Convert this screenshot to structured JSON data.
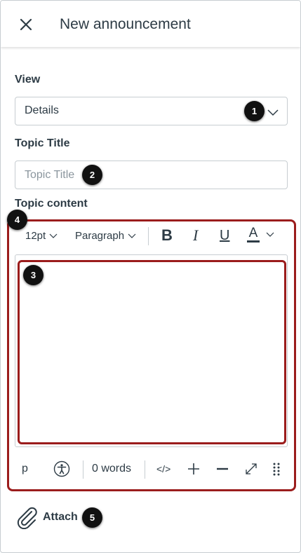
{
  "header": {
    "title": "New announcement",
    "close_icon": "close-icon"
  },
  "view": {
    "label": "View",
    "selected": "Details"
  },
  "topic_title": {
    "label": "Topic Title",
    "placeholder": "Topic Title"
  },
  "topic_content": {
    "label": "Topic content",
    "toolbar": {
      "font_size": "12pt",
      "block_format": "Paragraph",
      "bold": "B",
      "italic": "I",
      "underline": "U",
      "text_color": "A"
    },
    "statusbar": {
      "path": "p",
      "word_count": "0 words",
      "html_toggle": "</>"
    }
  },
  "attach": {
    "label": "Attach"
  },
  "callouts": [
    "1",
    "2",
    "3",
    "4",
    "5"
  ],
  "colors": {
    "highlight": "#9b1c1c",
    "text": "#2d3b45",
    "border": "#c7cdd1",
    "callout_bg": "#111111"
  }
}
